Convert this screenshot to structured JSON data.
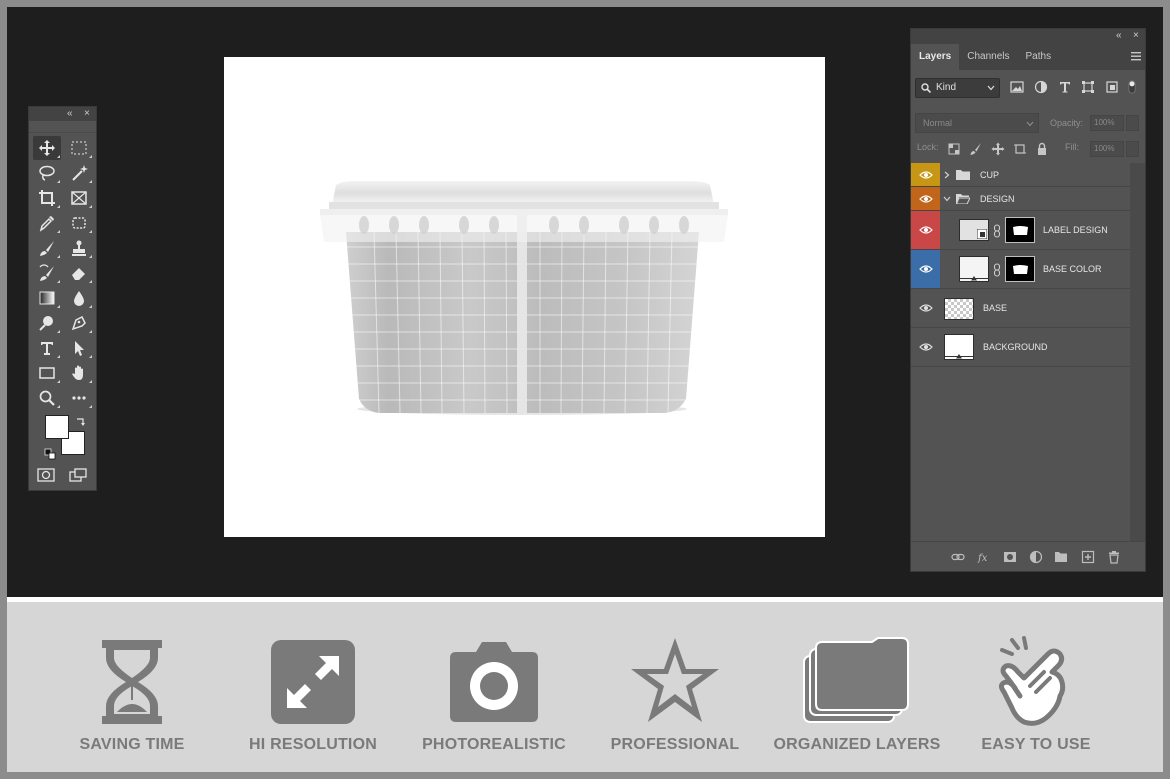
{
  "colors": {
    "workspace": "#1e1e1e",
    "panel": "#535353",
    "panel_dark": "#434343",
    "feature_bg": "#d6d6d6",
    "feature_icon": "#7a7a7a",
    "tag_yellow": "#c79614",
    "tag_orange": "#c0651a",
    "tag_red": "#c94747",
    "tag_blue": "#3b6ea8"
  },
  "tools_panel": {
    "collapse_glyph": "«",
    "close_glyph": "×",
    "tools": [
      "move-tool-icon",
      "marquee-tool-icon",
      "lasso-tool-icon",
      "magic-wand-tool-icon",
      "crop-tool-icon",
      "frame-tool-icon",
      "eyedropper-tool-icon",
      "patch-tool-icon",
      "brush-tool-icon",
      "stamp-tool-icon",
      "history-brush-tool-icon",
      "eraser-tool-icon",
      "gradient-tool-icon",
      "blur-tool-icon",
      "dodge-tool-icon",
      "pen-tool-icon",
      "type-tool-icon",
      "path-selection-tool-icon",
      "rectangle-tool-icon",
      "hand-tool-icon",
      "zoom-tool-icon",
      "more-tools-icon"
    ]
  },
  "layers_panel": {
    "collapse_glyph": "«",
    "close_glyph": "×",
    "tabs": [
      "Layers",
      "Channels",
      "Paths"
    ],
    "active_tab": "Layers",
    "filter_kind": "Kind",
    "blend_mode": "Normal",
    "opacity_label": "Opacity:",
    "opacity_value": "100%",
    "lock_label": "Lock:",
    "fill_label": "Fill:",
    "fill_value": "100%",
    "layers": [
      {
        "name": "CUP",
        "type": "group",
        "tag": "yellow"
      },
      {
        "name": "DESIGN",
        "type": "group",
        "tag": "orange",
        "expanded": true
      },
      {
        "name": "LABEL DESIGN",
        "type": "smart",
        "tag": "red"
      },
      {
        "name": "BASE COLOR",
        "type": "fill",
        "tag": "blue"
      },
      {
        "name": "BASE",
        "type": "transparent",
        "tag": "none"
      },
      {
        "name": "BACKGROUND",
        "type": "fill",
        "tag": "none"
      }
    ]
  },
  "features": [
    {
      "label": "SAVING TIME",
      "icon": "hourglass-icon"
    },
    {
      "label": "HI RESOLUTION",
      "icon": "expand-arrows-icon"
    },
    {
      "label": "PHOTOREALISTIC",
      "icon": "camera-icon"
    },
    {
      "label": "PROFESSIONAL",
      "icon": "star-icon"
    },
    {
      "label": "ORGANIZED LAYERS",
      "icon": "folders-icon"
    },
    {
      "label": "EASY TO USE",
      "icon": "pointing-hand-icon"
    }
  ]
}
